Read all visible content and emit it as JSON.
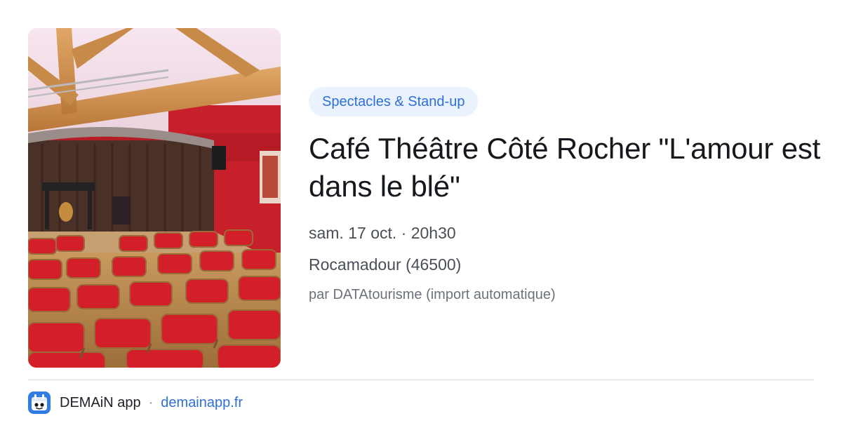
{
  "event": {
    "category_tag": "Spectacles & Stand-up",
    "title": "Café Théâtre Côté Rocher \"L'amour est dans le blé\"",
    "datetime": "sam. 17 oct. · 20h30",
    "location": "Rocamadour (46500)",
    "source": "par DATAtourisme (import automatique)"
  },
  "image": {
    "alt": "Salle de café-théâtre avec chaises rouges et rideau"
  },
  "footer": {
    "app_name": "DEMAiN app",
    "separator": "·",
    "domain": "demainapp.fr"
  },
  "colors": {
    "accent": "#2f6fd6",
    "tag_background": "#eaf2fd",
    "title": "#15181d",
    "secondary_text": "#4a4f57",
    "muted_text": "#6c727b",
    "divider": "#d9dde3"
  }
}
